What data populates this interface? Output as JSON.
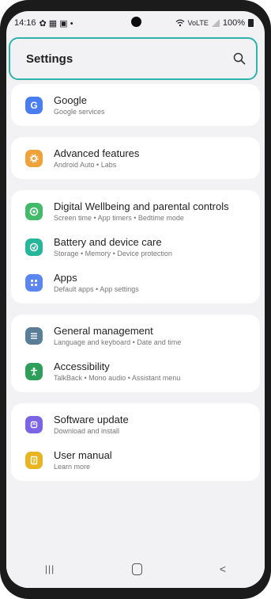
{
  "status_bar": {
    "time": "14:16",
    "left_icons": "✿ ▦ ▣ •",
    "signal": "VoLTE",
    "battery": "100%"
  },
  "header": {
    "title": "Settings",
    "search_icon": "search-icon"
  },
  "colors": {
    "highlight": "#2fb3ab",
    "google": "#4a7ef0",
    "advanced": "#f0a23a",
    "wellbeing": "#43b96a",
    "battery": "#28b69a",
    "apps": "#5b85ef",
    "general": "#5a7e96",
    "accessibility": "#2d9f5a",
    "software": "#7b64e6",
    "manual": "#e8b520"
  },
  "groups": [
    [
      {
        "title": "Google",
        "subtitle": "Google services",
        "icon": "google-icon"
      }
    ],
    [
      {
        "title": "Advanced features",
        "subtitle": "Android Auto • Labs",
        "icon": "advanced-features-icon"
      }
    ],
    [
      {
        "title": "Digital Wellbeing and parental controls",
        "subtitle": "Screen time • App timers • Bedtime mode",
        "icon": "wellbeing-icon"
      },
      {
        "title": "Battery and device care",
        "subtitle": "Storage • Memory • Device protection",
        "icon": "device-care-icon"
      },
      {
        "title": "Apps",
        "subtitle": "Default apps • App settings",
        "icon": "apps-icon"
      }
    ],
    [
      {
        "title": "General management",
        "subtitle": "Language and keyboard • Date and time",
        "icon": "general-management-icon"
      },
      {
        "title": "Accessibility",
        "subtitle": "TalkBack • Mono audio • Assistant menu",
        "icon": "accessibility-icon"
      }
    ],
    [
      {
        "title": "Software update",
        "subtitle": "Download and install",
        "icon": "software-update-icon"
      },
      {
        "title": "User manual",
        "subtitle": "Learn more",
        "icon": "user-manual-icon"
      }
    ]
  ],
  "navbar": {
    "recents": "|||",
    "back": "<"
  }
}
